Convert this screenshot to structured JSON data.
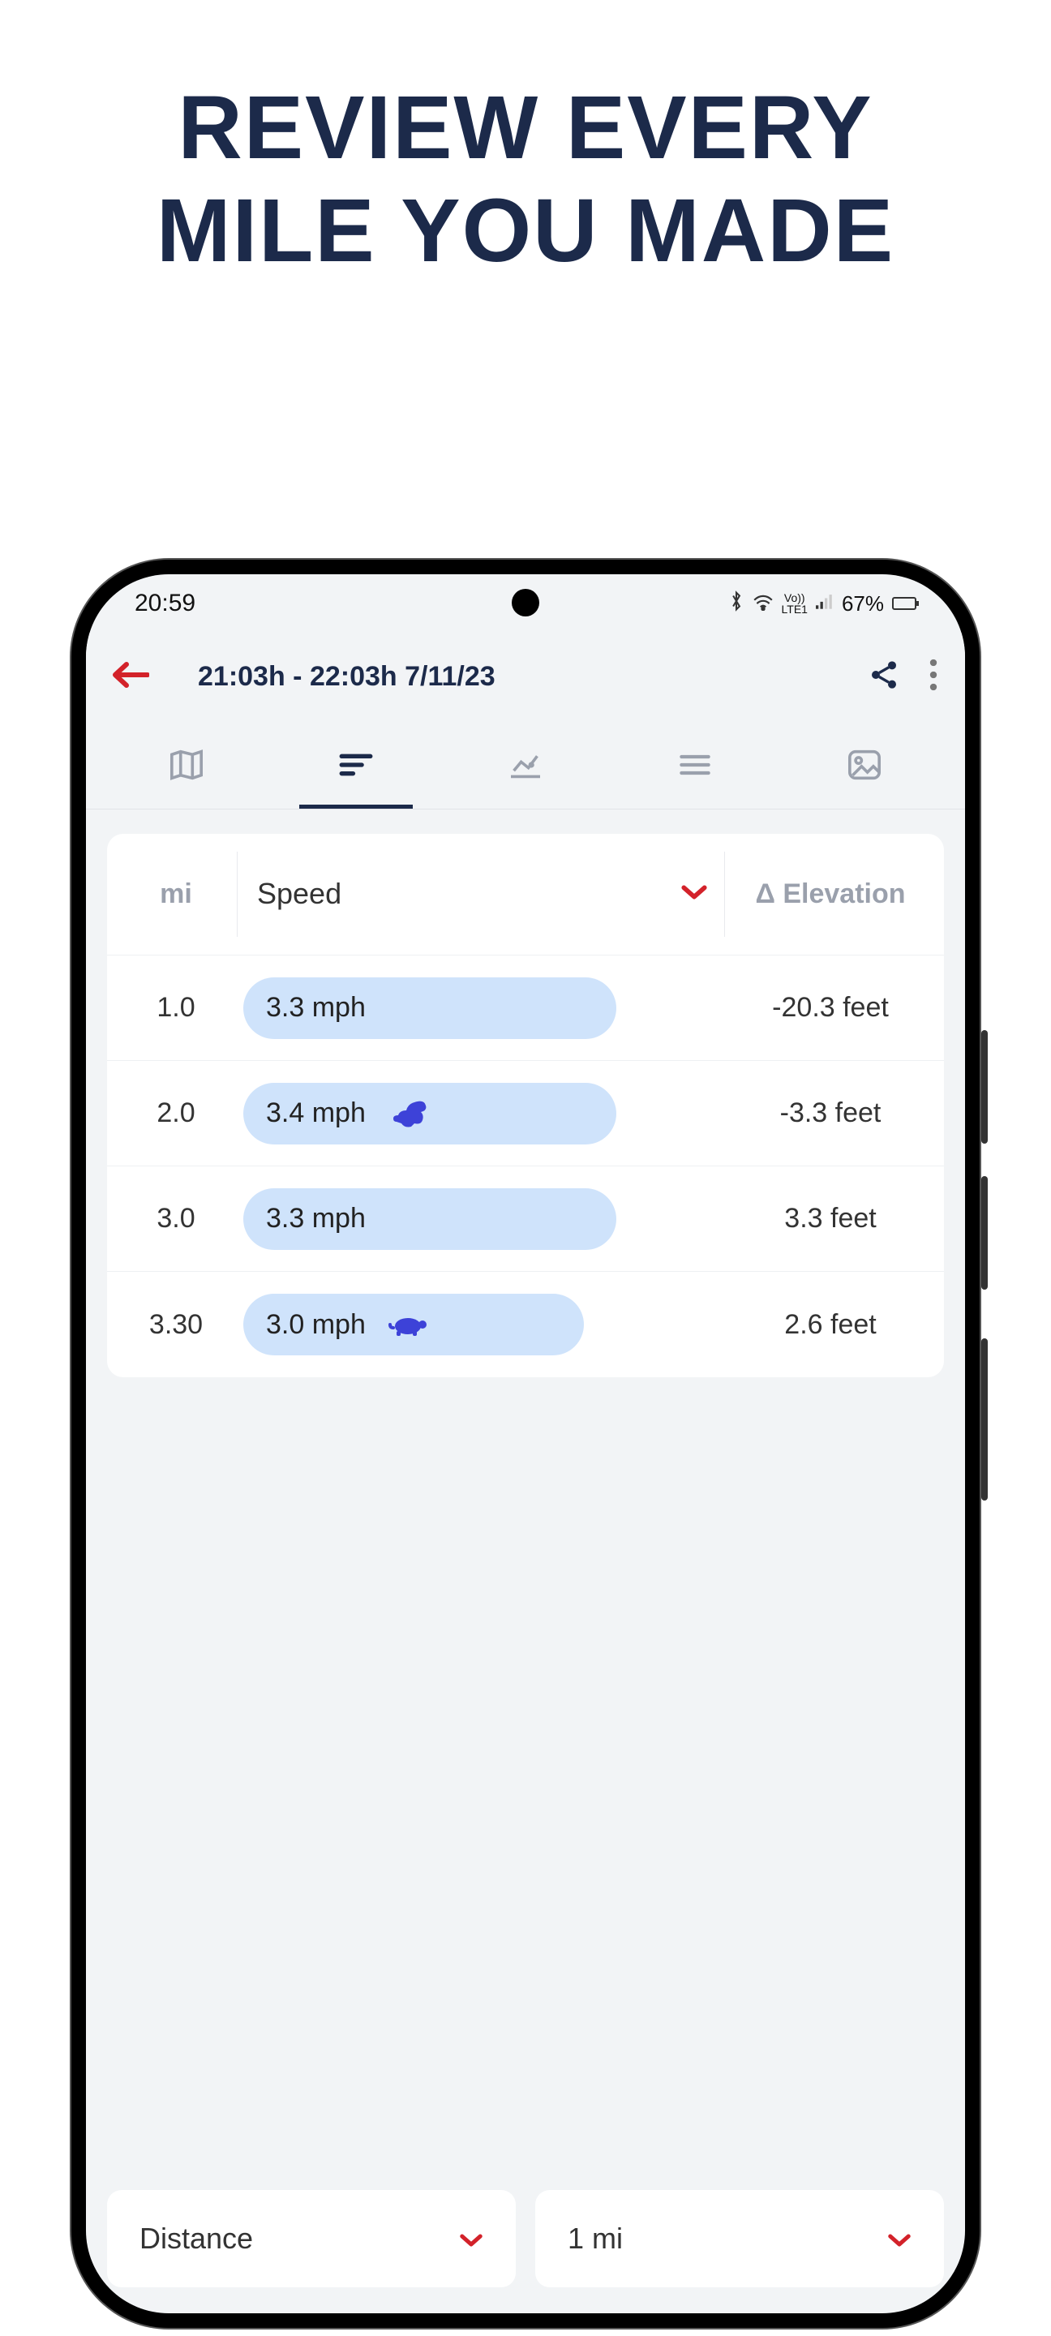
{
  "headline_line1": "REVIEW EVERY",
  "headline_line2": "MILE YOU MADE",
  "statusbar": {
    "time": "20:59",
    "battery_pct": "67%"
  },
  "appbar": {
    "title": "21:03h - 22:03h  7/11/23"
  },
  "table": {
    "mi_header": "mi",
    "speed_header": "Speed",
    "elev_header": "Δ Elevation",
    "rows": [
      {
        "mi": "1.0",
        "speed": "3.3 mph",
        "mark": "none",
        "elev": "-20.3 feet"
      },
      {
        "mi": "2.0",
        "speed": "3.4 mph",
        "mark": "rabbit",
        "elev": "-3.3 feet"
      },
      {
        "mi": "3.0",
        "speed": "3.3 mph",
        "mark": "none",
        "elev": "3.3 feet"
      },
      {
        "mi": "3.30",
        "speed": "3.0 mph",
        "mark": "turtle",
        "elev": "2.6 feet"
      }
    ]
  },
  "bottom": {
    "left_label": "Distance",
    "right_label": "1 mi"
  },
  "colors": {
    "brand_dark": "#1c2a4a",
    "accent_red": "#d3222a",
    "pill_bg": "#cfe3fb",
    "icon_blue": "#3d42d8"
  }
}
